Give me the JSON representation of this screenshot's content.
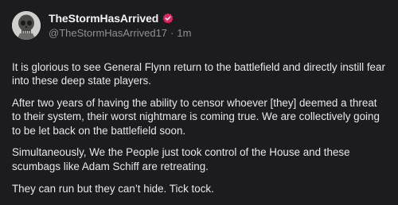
{
  "author": {
    "display_name": "TheStormHasArrived",
    "handle": "@TheStormHasArrived17",
    "time": "1m",
    "separator": "·",
    "verified_color": "#e0245e"
  },
  "post": {
    "paragraphs": [
      "It is glorious to see General Flynn return to the battlefield and directly instill fear into these deep state players.",
      "After two years of having the ability to censor whoever [they] deemed a threat to their system, their worst nightmare is coming true. We are collectively going to be let back on the battlefield soon.",
      "Simultaneously, We the People just took control of the House and these scumbags like Adam Schiff are retreating.",
      "They can run but they can’t hide. Tick tock."
    ]
  },
  "icons": {
    "avatar": "skull-avatar",
    "verified": "verified-badge-icon"
  }
}
